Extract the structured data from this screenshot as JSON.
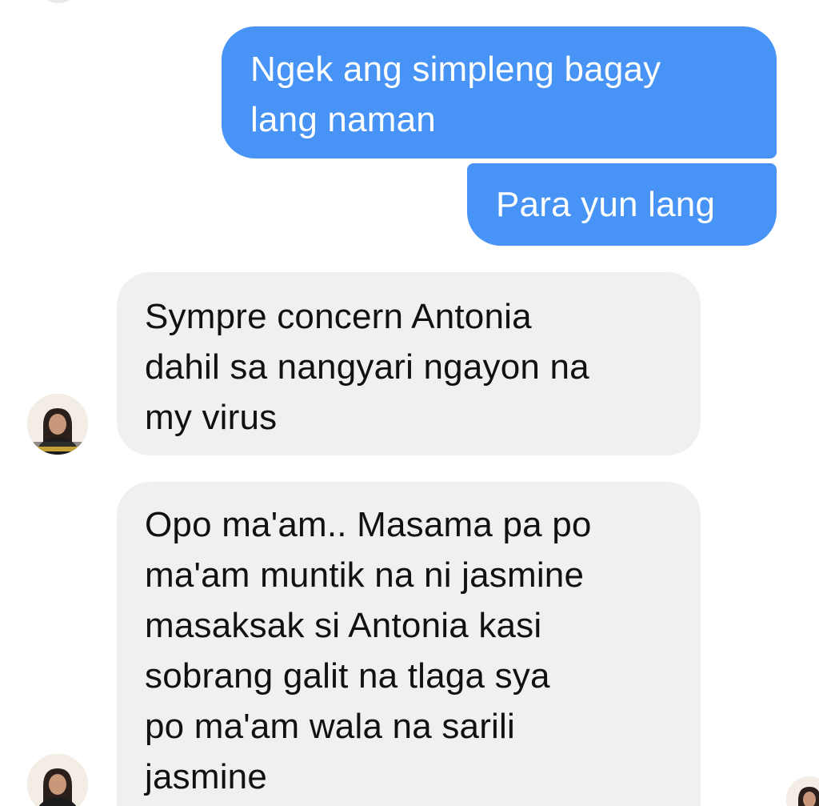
{
  "conversation": {
    "messages": [
      {
        "id": "msg-1",
        "direction": "sent",
        "text": "Ngek ang simpleng bagay\nlang naman"
      },
      {
        "id": "msg-2",
        "direction": "sent",
        "text": "Para yun lang"
      },
      {
        "id": "msg-3",
        "direction": "received",
        "text": "Sympre concern Antonia\ndahil sa nangyari ngayon na\nmy virus"
      },
      {
        "id": "msg-4",
        "direction": "received",
        "text": "Opo ma'am.. Masama pa po\nma'am muntik na ni jasmine\nmasaksak si Antonia kasi\nsobrang galit na tlaga sya\npo ma'am wala na sarili\njasmine"
      }
    ]
  },
  "avatars": {
    "icon": "contact-photo",
    "read_receipt_icon": "seen-avatar"
  },
  "colors": {
    "sent_bubble": "#4893f6",
    "received_bubble": "#f0f0f0",
    "sent_text": "#ffffff",
    "received_text": "#111111",
    "background": "#ffffff"
  }
}
